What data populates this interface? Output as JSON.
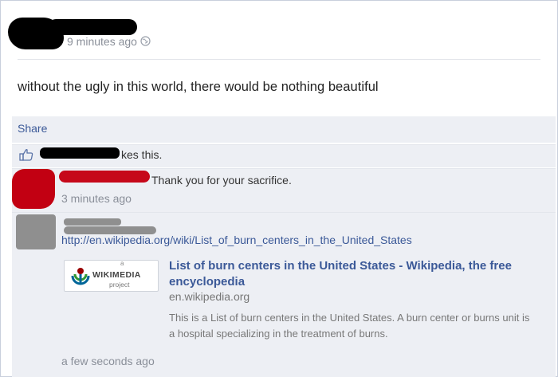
{
  "post": {
    "timestamp": "9 minutes ago",
    "status": "without the ugly in this world, there would be nothing beautiful"
  },
  "actions": {
    "share_label": "Share"
  },
  "likes": {
    "text": "kes this."
  },
  "comments": [
    {
      "text": "Thank you for your sacrifice.",
      "timestamp": "3 minutes ago"
    },
    {
      "link": "http://en.wikipedia.org/wiki/List_of_burn_centers_in_the_United_States",
      "preview": {
        "logo_text": "WIKIMEDIA",
        "logo_sub": "project",
        "logo_small": "a",
        "title": "List of burn centers in the United States - Wikipedia, the free encyclopedia",
        "domain": "en.wikipedia.org",
        "description": "This is a List of burn centers in the United States. A burn center or burns unit is a hospital specializing in the treatment of burns."
      },
      "timestamp": "a few seconds ago"
    }
  ],
  "colors": {
    "link": "#3b5998",
    "muted": "#8a8f99",
    "bar": "#edeff4"
  }
}
